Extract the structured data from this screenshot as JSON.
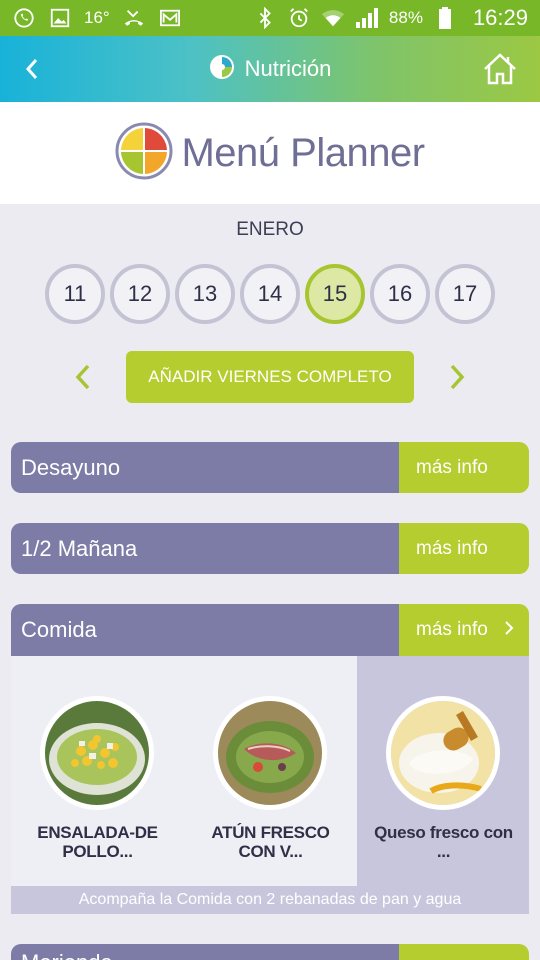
{
  "status_bar": {
    "temp": "16°",
    "battery": "88%",
    "time": "16:29"
  },
  "toolbar": {
    "title": "Nutrición"
  },
  "logo": {
    "text": "Menú Planner"
  },
  "calendar": {
    "month": "ENERO",
    "days": [
      "11",
      "12",
      "13",
      "14",
      "15",
      "16",
      "17"
    ],
    "selected_day": "15"
  },
  "add_button": {
    "label": "AÑADIR VIERNES COMPLETO"
  },
  "meals": [
    {
      "name": "Desayuno",
      "more": "más info"
    },
    {
      "name": "1/2 Mañana",
      "more": "más info"
    },
    {
      "name": "Comida",
      "more": "más info"
    },
    {
      "name": "Merienda",
      "more": ""
    }
  ],
  "dishes": [
    {
      "name_line1": "ENSALADA-DE",
      "name_line2": "POLLO..."
    },
    {
      "name_line1": "ATÚN FRESCO",
      "name_line2": "CON V..."
    },
    {
      "name_line1": "Queso fresco con",
      "name_line2": "..."
    }
  ],
  "meal_note": "Acompaña la Comida con 2 rebanadas de pan y agua",
  "colors": {
    "green": "#b6cd2f",
    "purple": "#7c7ca6",
    "status_green": "#77b728"
  }
}
